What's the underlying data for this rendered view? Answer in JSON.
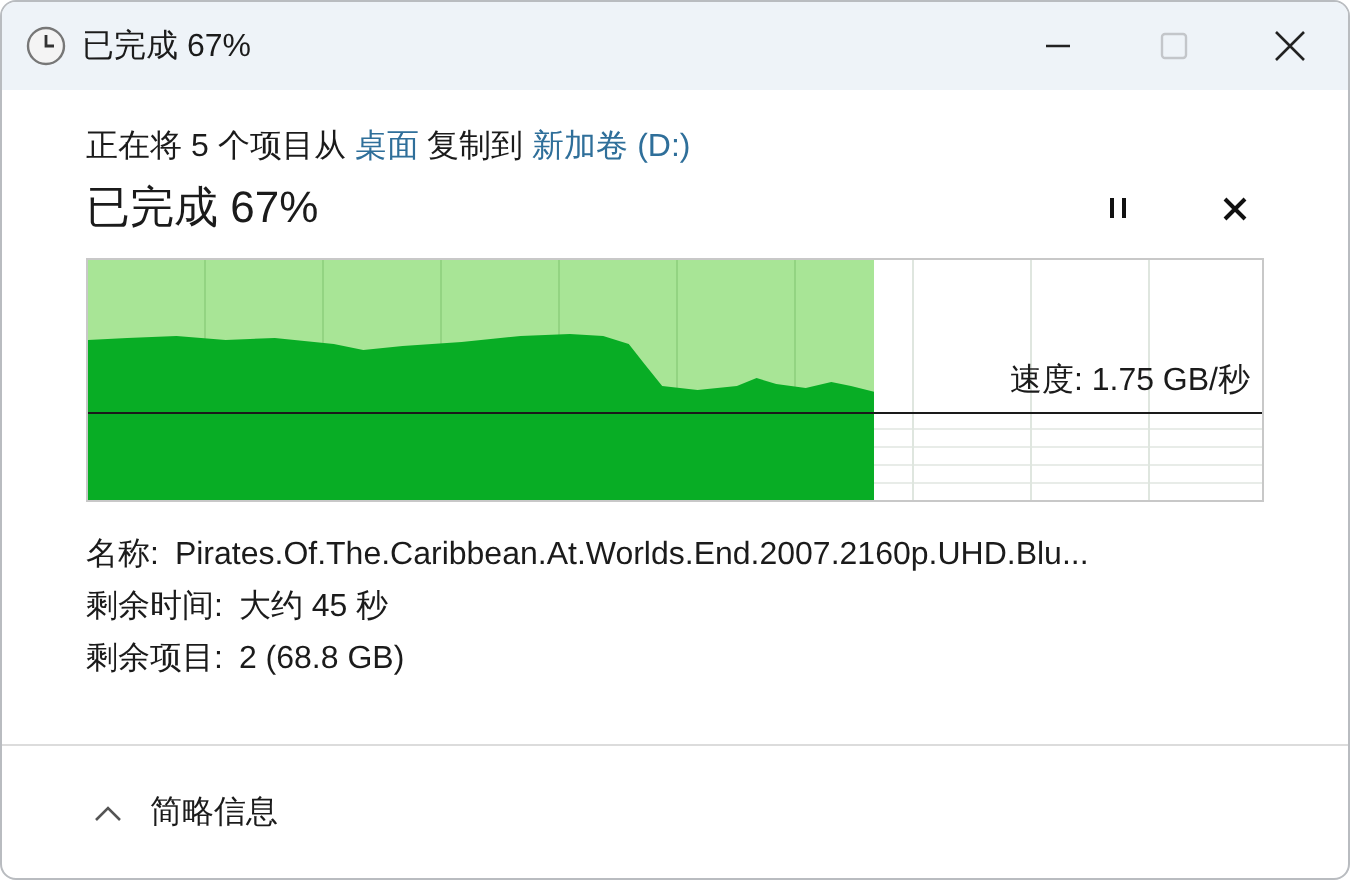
{
  "window": {
    "title": "已完成 67%"
  },
  "copy_line": {
    "prefix": "正在将 5 个项目从",
    "source": "桌面",
    "middle": "复制到",
    "destination": "新加卷 (D:)"
  },
  "heading": "已完成 67%",
  "progress": {
    "level": 0.67,
    "paused": false
  },
  "speed": "速度: 1.75 GB/秒",
  "details": [
    {
      "label": "名称:",
      "value": "Pirates.Of.The.Caribbean.At.Worlds.End.2007.2160p.UHD.Blu..."
    },
    {
      "label": "剩余时间:",
      "value": "大约 45 秒"
    },
    {
      "label": "剩余项目:",
      "value": "2 (68.8 GB)"
    }
  ],
  "footer": {
    "toggle": "简略信息",
    "expanded": true
  }
}
